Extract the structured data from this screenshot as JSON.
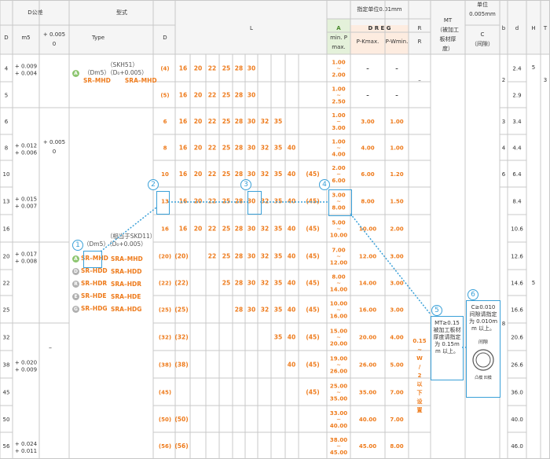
{
  "headers": {
    "d_tol": "D公差",
    "d": "D",
    "m5": "m5",
    "tol_plus": "+ 0.005",
    "tol_zero": "0",
    "shape": "型式",
    "type": "Type",
    "type_d": "D",
    "l": "L",
    "spec_unit": "指定单位0.01mm",
    "a_label": "A",
    "dreg_label": "D R E G",
    "mt": "MT（被加工板材厚度）",
    "unit": "单位 0.005mm",
    "c_gap": "C（间隙）",
    "min_p": "min. P max.",
    "pkmax": "P-Kmax.",
    "pwmin": "P-Wmin.",
    "r": "R",
    "b": "b",
    "dcol": "d",
    "h": "H",
    "t": "T"
  },
  "rows": [
    {
      "D": "4",
      "m5": "+ 0.009 + 0.004",
      "d": "2.4",
      "L": [
        "16",
        "20",
        "22",
        "25",
        "28",
        "30"
      ],
      "p": "1.00 ~ 2.00",
      "pk": "–",
      "pw": "–"
    },
    {
      "D": "5",
      "d": "2.9",
      "L": [
        "16",
        "20",
        "22",
        "25",
        "28",
        "30"
      ],
      "p": "1.00 ~ 2.50",
      "pk": "–",
      "pw": "–"
    },
    {
      "D": "6",
      "m5": "",
      "d": "3.4",
      "b": "3",
      "L": [
        "16",
        "20",
        "22",
        "25",
        "28",
        "30",
        "32",
        "35"
      ],
      "p": "1.00 ~ 3.00",
      "pk": "3.00",
      "pw": "1.00"
    },
    {
      "D": "8",
      "m5": "+ 0.012 + 0.006",
      "d": "4.4",
      "b": "4",
      "L": [
        "16",
        "20",
        "22",
        "25",
        "28",
        "30",
        "32",
        "35",
        "40"
      ],
      "p": "1.00 ~ 4.00",
      "pk": "4.00",
      "pw": "1.00"
    },
    {
      "D": "10",
      "d": "6.4",
      "b": "6",
      "L": [
        "16",
        "20",
        "22",
        "25",
        "28",
        "30",
        "32",
        "35",
        "40",
        "(45)"
      ],
      "p": "2.00 ~ 6.00",
      "pk": "6.00",
      "pw": "1.20"
    },
    {
      "D": "13",
      "m5": "+ 0.015 + 0.007",
      "d": "8.4",
      "L": [
        "16",
        "20",
        "22",
        "25",
        "28",
        "30",
        "32",
        "35",
        "40",
        "(45)"
      ],
      "p": "3.00 ~ 8.00",
      "pk": "8.00",
      "pw": "1.50"
    },
    {
      "D": "16",
      "d": "10.6",
      "L": [
        "16",
        "20",
        "22",
        "25",
        "28",
        "30",
        "32",
        "35",
        "40",
        "(45)"
      ],
      "p": "5.00 ~ 10.00",
      "pk": "10.00",
      "pw": "2.00"
    },
    {
      "D": "20",
      "m5": "+ 0.017 + 0.008",
      "d": "12.6",
      "L": [
        "(20)",
        "22",
        "25",
        "28",
        "30",
        "32",
        "35",
        "40",
        "(45)"
      ],
      "p": "7.00 ~ 12.00",
      "pk": "12.00",
      "pw": "3.00"
    },
    {
      "D": "22",
      "d": "14.6",
      "L": [
        "(22)",
        "25",
        "28",
        "30",
        "32",
        "35",
        "40",
        "(45)"
      ],
      "p": "8.00 ~ 14.00",
      "pk": "14.00",
      "pw": "3.00"
    },
    {
      "D": "25",
      "d": "16.6",
      "L": [
        "(25)",
        "28",
        "30",
        "32",
        "35",
        "40",
        "(45)"
      ],
      "p": "10.00 ~ 16.00",
      "pk": "16.00",
      "pw": "3.00"
    },
    {
      "D": "32",
      "m5": "",
      "d": "20.6",
      "L": [
        "(32)",
        "35",
        "40",
        "(45)"
      ],
      "p": "15.00 ~ 20.00",
      "pk": "20.00",
      "pw": "4.00"
    },
    {
      "D": "38",
      "m5": "+ 0.020 + 0.009",
      "d": "26.6",
      "L": [
        "(38)",
        "40",
        "(45)"
      ],
      "p": "19.00 ~ 26.00",
      "pk": "26.00",
      "pw": "5.00"
    },
    {
      "D": "45",
      "d": "36.0",
      "L": [
        "(45)"
      ],
      "p": "25.00 ~ 35.00",
      "pk": "35.00",
      "pw": "7.00"
    },
    {
      "D": "50",
      "d": "40.0",
      "L": [
        "(50)"
      ],
      "p": "33.00 ~ 40.00",
      "pk": "40.00",
      "pw": "7.00"
    },
    {
      "D": "56",
      "m5": "+ 0.024 + 0.011",
      "d": "46.0",
      "L": [
        "(56)"
      ],
      "p": "38.00 ~ 45.00",
      "pk": "45.00",
      "pw": "8.00"
    }
  ],
  "type_top": {
    "title": "（SKH51）",
    "sub": "（Dm5）（D₀+0.005）",
    "names": [
      "SR–MHD",
      "SRA–MHD"
    ]
  },
  "type_bottom": {
    "title": "（相当于SKD11）",
    "sub": "（Dm5）（D₀+0.005）",
    "left": [
      "SR–MHD",
      "SR–HDD",
      "SR–HDR",
      "SR–HDE",
      "SR–HDG"
    ],
    "right": [
      "SRA–MHD",
      "SRA–HDD",
      "SRA–HDR",
      "SRA–HDE",
      "SRA–HDG"
    ]
  },
  "dash_mid": "–",
  "r_col_text": "0.15 ~ W/2 以下设置",
  "b_vals": {
    "top": "2",
    "bottom": "8"
  },
  "h_vals": {
    "top": "5",
    "mid": "5"
  },
  "t_vals": {
    "top": "3"
  },
  "callouts": {
    "n1": "1",
    "n2": "2",
    "n3": "3",
    "n4": "4",
    "n5": "5",
    "n6": "6",
    "note5": "MT≥0.15 被加工板材厚度请指定为 0.15mm 以上。",
    "note6": "C≥0.010 间隙请指定为 0.010mm 以上。",
    "note6_sub": "间隙",
    "note6_tiny": "凸模  凹模"
  },
  "colors": {
    "orange": "#ee7b1c",
    "blue": "#3aa0d8"
  }
}
